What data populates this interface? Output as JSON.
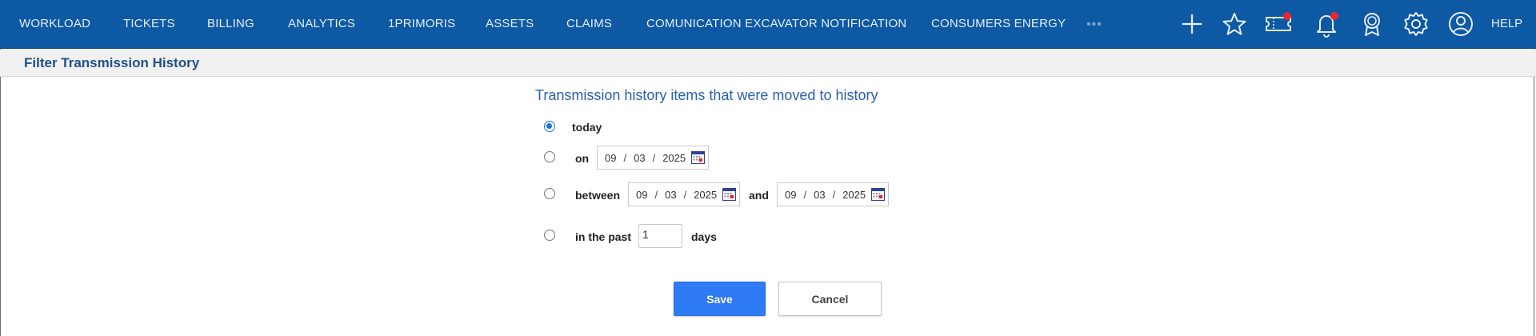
{
  "nav": {
    "items": [
      "WORKLOAD",
      "TICKETS",
      "BILLING",
      "ANALYTICS",
      "1PRIMORIS",
      "ASSETS",
      "CLAIMS",
      "COMUNICATION EXCAVATOR NOTIFICATION",
      "CONSUMERS ENERGY"
    ],
    "more": "•••",
    "help": "HELP",
    "icons": [
      "plus-icon",
      "star-icon",
      "ticket-icon",
      "bell-icon",
      "award-icon",
      "gear-icon",
      "user-icon"
    ]
  },
  "filterbar": {
    "title": "Filter Transmission History"
  },
  "form": {
    "heading": "Transmission history items that were moved to history",
    "options": {
      "today": "today",
      "on": "on",
      "between": "between",
      "and": "and",
      "in_the_past": "in the past",
      "days": "days"
    },
    "selected": "today",
    "on_date": {
      "month": "09",
      "day": "03",
      "year": "2025"
    },
    "between_start": {
      "month": "09",
      "day": "03",
      "year": "2025"
    },
    "between_end": {
      "month": "09",
      "day": "03",
      "year": "2025"
    },
    "days_value": "1",
    "date_sep": "/"
  },
  "buttons": {
    "save": "Save",
    "cancel": "Cancel"
  },
  "colors": {
    "nav_bg": "#0e59a3",
    "accent": "#2f7bf5",
    "badge": "#e8262f",
    "title": "#1f4f86"
  }
}
